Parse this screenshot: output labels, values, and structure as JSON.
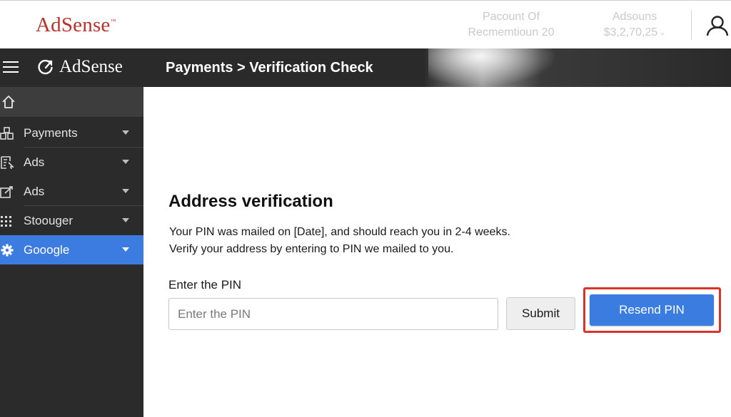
{
  "header": {
    "brand": "AdSense",
    "account": {
      "line1": "Pacount Of",
      "line2": "Recmemtioun 20"
    },
    "balance": {
      "label": "Adsouns",
      "value": "$3,2,70,25"
    }
  },
  "appbar": {
    "logo_text": "AdSense",
    "breadcrumb": "Payments > Verification Check"
  },
  "sidebar": {
    "items": [
      {
        "label": "Payments",
        "icon": "payments-icon"
      },
      {
        "label": "Ads",
        "icon": "ads-list-icon"
      },
      {
        "label": "Ads",
        "icon": "ads-edit-icon"
      },
      {
        "label": "Stoouger",
        "icon": "grid-icon"
      },
      {
        "label": "Gooogle",
        "icon": "gear-icon",
        "active": true
      }
    ]
  },
  "main": {
    "title": "Address verification",
    "description_line1": "Your PIN was mailed on [Date], and should reach you in 2-4 weeks.",
    "description_line2": "Verify your address by entering to PIN we mailed to you.",
    "pin_label": "Enter the PIN",
    "pin_placeholder": "Enter the PIN",
    "pin_value": "",
    "submit_label": "Submit",
    "resend_label": "Resend PIN"
  },
  "colors": {
    "brand_red": "#b8312b",
    "accent_blue": "#3b7ce0",
    "highlight_red": "#d9342b",
    "sidebar_bg": "#2b2b2b"
  }
}
